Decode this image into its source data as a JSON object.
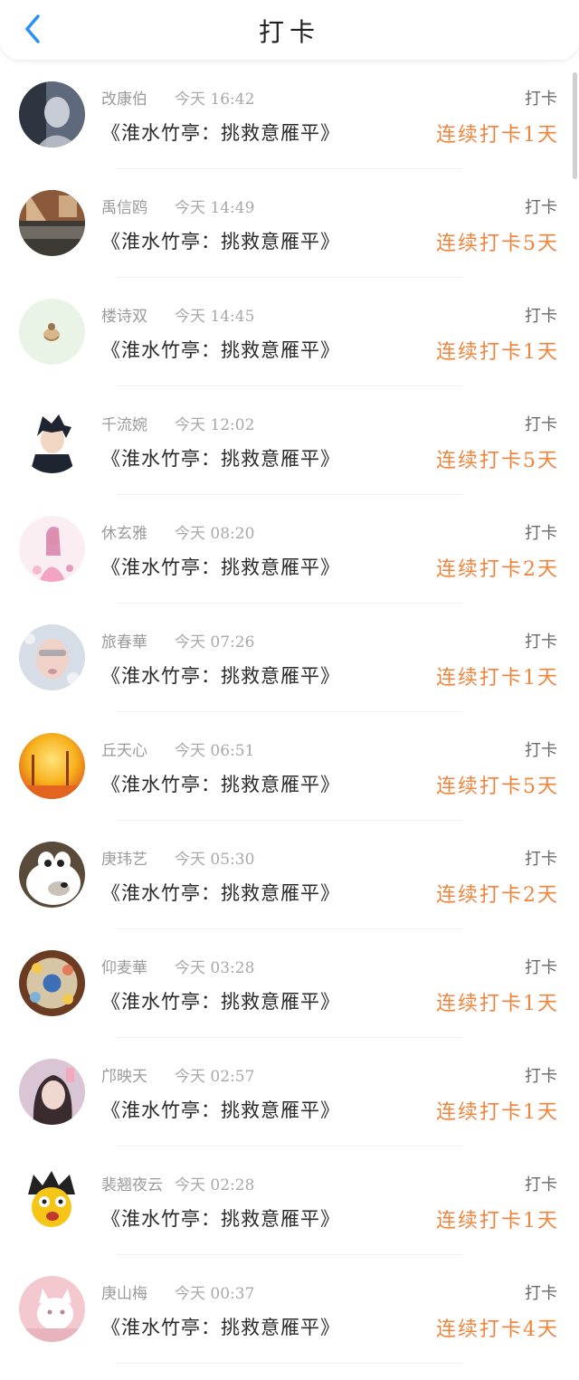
{
  "header": {
    "title": "打卡",
    "back_icon": "chevron-left-icon",
    "back_color": "#2a8ff7"
  },
  "accent_color": "#f0843c",
  "items": [
    {
      "name": "改康伯",
      "time": "今天 16:42",
      "book": "《淮水竹亭：挑救意雁平》",
      "action": "打卡",
      "streak": "连续打卡1天",
      "avatar": {
        "kind": "photo-portrait",
        "c1": "#5e6a7c",
        "c2": "#c8ccd4",
        "c3": "#2f3540"
      }
    },
    {
      "name": "禹信鸥",
      "time": "今天 14:49",
      "book": "《淮水竹亭：挑救意雁平》",
      "action": "打卡",
      "streak": "连续打卡5天",
      "avatar": {
        "kind": "photo-room",
        "c1": "#8a5a3a",
        "c2": "#e8c9a3",
        "c3": "#3d3a36"
      }
    },
    {
      "name": "楼诗双",
      "time": "今天 14:45",
      "book": "《淮水竹亭：挑救意雁平》",
      "action": "打卡",
      "streak": "连续打卡1天",
      "avatar": {
        "kind": "light-sketch",
        "c1": "#eaf4e6",
        "c2": "#d9b58a",
        "c3": "#9a7650"
      }
    },
    {
      "name": "千流婉",
      "time": "今天 12:02",
      "book": "《淮水竹亭：挑救意雁平》",
      "action": "打卡",
      "streak": "连续打卡5天",
      "avatar": {
        "kind": "anime-boy",
        "c1": "#ffffff",
        "c2": "#1e2530",
        "c3": "#f2d6c4"
      }
    },
    {
      "name": "休玄雅",
      "time": "今天 08:20",
      "book": "《淮水竹亭：挑救意雁平》",
      "action": "打卡",
      "streak": "连续打卡2天",
      "avatar": {
        "kind": "anime-girl-pink",
        "c1": "#fbeef2",
        "c2": "#f3a4c2",
        "c3": "#d57ba6"
      }
    },
    {
      "name": "旅春華",
      "time": "今天 07:26",
      "book": "《淮水竹亭：挑救意雁平》",
      "action": "打卡",
      "streak": "连续打卡1天",
      "avatar": {
        "kind": "photo-face-bubbles",
        "c1": "#d6dde6",
        "c2": "#c79aa3",
        "c3": "#7f8ea0"
      }
    },
    {
      "name": "丘天心",
      "time": "今天 06:51",
      "book": "《淮水竹亭：挑救意雁平》",
      "action": "打卡",
      "streak": "连续打卡5天",
      "avatar": {
        "kind": "autumn-forest",
        "c1": "#f7b21c",
        "c2": "#e3641e",
        "c3": "#8a3b12"
      }
    },
    {
      "name": "庚玮艺",
      "time": "今天 05:30",
      "book": "《淮水竹亭：挑救意雁平》",
      "action": "打卡",
      "streak": "连续打卡2天",
      "avatar": {
        "kind": "cartoon-bear",
        "c1": "#5a4a3a",
        "c2": "#ffffff",
        "c3": "#c9c2b8"
      }
    },
    {
      "name": "仰麦華",
      "time": "今天 03:28",
      "book": "《淮水竹亭：挑救意雁平》",
      "action": "打卡",
      "streak": "连续打卡1天",
      "avatar": {
        "kind": "wheel-toys",
        "c1": "#6b3c22",
        "c2": "#f2c94c",
        "c3": "#3b6fb6"
      }
    },
    {
      "name": "邝映天",
      "time": "今天 02:57",
      "book": "《淮水竹亭：挑救意雁平》",
      "action": "打卡",
      "streak": "连续打卡1天",
      "avatar": {
        "kind": "photo-girl",
        "c1": "#d9c5d4",
        "c2": "#3a2c2e",
        "c3": "#f0d7cf"
      }
    },
    {
      "name": "裴翘夜云",
      "time": "今天 02:28",
      "book": "《淮水竹亭：挑救意雁平》",
      "action": "打卡",
      "streak": "连续打卡1天",
      "avatar": {
        "kind": "cartoon-yellow",
        "c1": "#ffffff",
        "c2": "#f5c518",
        "c3": "#222222"
      }
    },
    {
      "name": "庚山梅",
      "time": "今天 00:37",
      "book": "《淮水竹亭：挑救意雁平》",
      "action": "打卡",
      "streak": "连续打卡4天",
      "avatar": {
        "kind": "photo-pink-cat",
        "c1": "#f3c9cf",
        "c2": "#ffffff",
        "c3": "#b98790"
      }
    }
  ]
}
